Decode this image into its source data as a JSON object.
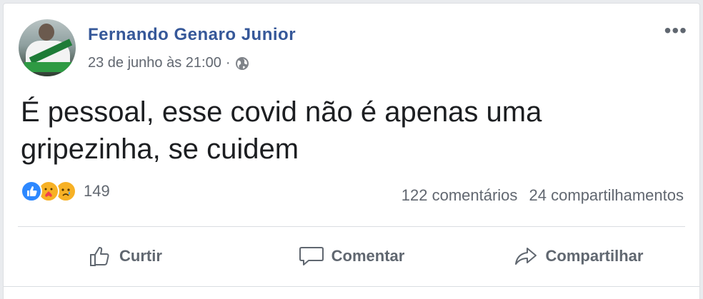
{
  "post": {
    "author": "Fernando Genaro Junior",
    "timestamp": "23 de junho às 21:00",
    "separator": "·",
    "privacy_icon": "globe-icon",
    "more_label": "•••",
    "text_line1": "É pessoal, esse covid não é apenas uma",
    "text_line2": "gripezinha, se cuidem"
  },
  "reactions": {
    "icons": [
      "like-reaction-icon",
      "care-reaction-icon",
      "sad-reaction-icon"
    ],
    "count": "149"
  },
  "stats": {
    "comments": "122 comentários",
    "shares": "24 compartilhamentos"
  },
  "actions": {
    "like": "Curtir",
    "comment": "Comentar",
    "share": "Compartilhar"
  },
  "colors": {
    "author_link": "#365899",
    "meta_text": "#616770",
    "like_blue": "#2d88ff",
    "emoji_yellow": "#f7b125"
  }
}
